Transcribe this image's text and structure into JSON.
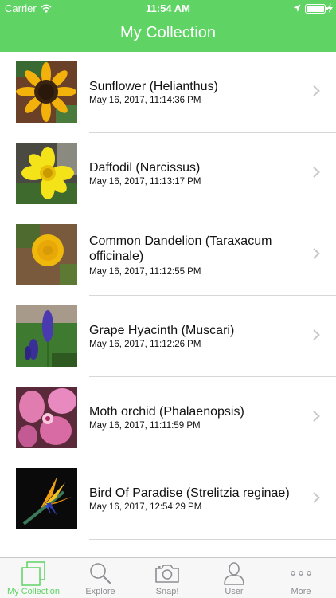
{
  "status_bar": {
    "carrier": "Carrier",
    "time": "11:54 AM",
    "battery_level": 1.0
  },
  "nav": {
    "title": "My Collection"
  },
  "items": [
    {
      "name": "Sunflower (Helianthus)",
      "date": "May 16, 2017, 11:14:36 PM",
      "thumb_icon": "sunflower-photo"
    },
    {
      "name": "Daffodil (Narcissus)",
      "date": "May 16, 2017, 11:13:17 PM",
      "thumb_icon": "daffodil-photo"
    },
    {
      "name": "Common Dandelion (Taraxacum officinale)",
      "date": "May 16, 2017, 11:12:55 PM",
      "thumb_icon": "dandelion-photo"
    },
    {
      "name": "Grape Hyacinth (Muscari)",
      "date": "May 16, 2017, 11:12:26 PM",
      "thumb_icon": "grape-hyacinth-photo"
    },
    {
      "name": "Moth orchid (Phalaenopsis)",
      "date": "May 16, 2017, 11:11:59 PM",
      "thumb_icon": "moth-orchid-photo"
    },
    {
      "name": "Bird Of Paradise (Strelitzia reginae)",
      "date": "May 16, 2017, 12:54:29 PM",
      "thumb_icon": "bird-of-paradise-photo"
    }
  ],
  "tabs": [
    {
      "label": "My Collection",
      "icon": "collection-icon",
      "active": true
    },
    {
      "label": "Explore",
      "icon": "search-icon",
      "active": false
    },
    {
      "label": "Snap!",
      "icon": "camera-icon",
      "active": false
    },
    {
      "label": "User",
      "icon": "user-icon",
      "active": false
    },
    {
      "label": "More",
      "icon": "more-icon",
      "active": false
    }
  ],
  "colors": {
    "accent": "#5fd364",
    "tab_inactive": "#8e8e93"
  }
}
